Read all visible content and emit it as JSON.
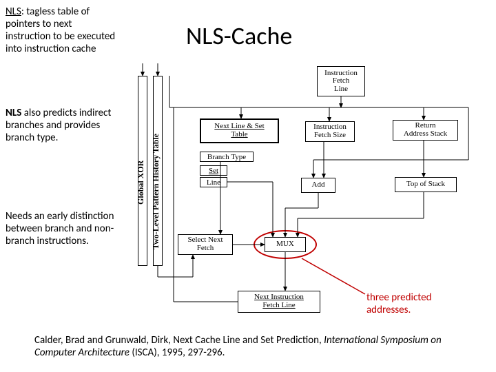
{
  "title": "NLS-Cache",
  "notes": {
    "top": {
      "prefix": "NLS",
      "rest": ": tagless table of pointers to next instruction to be executed into instruction cache"
    },
    "mid": {
      "prefix": "NLS",
      "rest": " also predicts indirect branches and provides branch type."
    },
    "bot": "Needs an early distinction between branch and non-branch instructions."
  },
  "annot": "three predicted addresses.",
  "citation": {
    "authors": "Calder, Brad and Grunwald, Dirk, Next Cache Line and Set Prediction, ",
    "venue": "International Symposium on Computer Architecture",
    "venue_abbr": " (ISCA)",
    "tail": ", 1995, 297-296."
  },
  "diagram": {
    "boxes": {
      "ifl": "Instruction\nFetch\nLine",
      "nls": {
        "l1": "Next Line & Set",
        "l2": "Table"
      },
      "ifs": "Instruction\nFetch Size",
      "ras": "Return\nAddress Stack",
      "btype": "Branch Type",
      "setline": {
        "l1": "Set",
        "l2": "Line"
      },
      "add": "Add",
      "tos": "Top of Stack",
      "select": "Select Next\nFetch",
      "mux": "MUX",
      "nifl": {
        "l1": "Next Instruction",
        "l2": "Fetch Line"
      }
    },
    "sidebars": {
      "left": "Global XOR",
      "right": "Two-Level Pattern History Table"
    }
  }
}
